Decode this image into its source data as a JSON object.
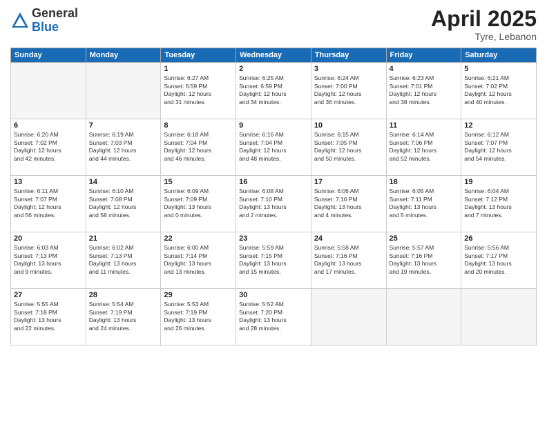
{
  "logo": {
    "general": "General",
    "blue": "Blue"
  },
  "title": {
    "month": "April 2025",
    "location": "Tyre, Lebanon"
  },
  "headers": [
    "Sunday",
    "Monday",
    "Tuesday",
    "Wednesday",
    "Thursday",
    "Friday",
    "Saturday"
  ],
  "weeks": [
    [
      {
        "day": "",
        "info": ""
      },
      {
        "day": "",
        "info": ""
      },
      {
        "day": "1",
        "info": "Sunrise: 6:27 AM\nSunset: 6:59 PM\nDaylight: 12 hours\nand 31 minutes."
      },
      {
        "day": "2",
        "info": "Sunrise: 6:25 AM\nSunset: 6:59 PM\nDaylight: 12 hours\nand 34 minutes."
      },
      {
        "day": "3",
        "info": "Sunrise: 6:24 AM\nSunset: 7:00 PM\nDaylight: 12 hours\nand 36 minutes."
      },
      {
        "day": "4",
        "info": "Sunrise: 6:23 AM\nSunset: 7:01 PM\nDaylight: 12 hours\nand 38 minutes."
      },
      {
        "day": "5",
        "info": "Sunrise: 6:21 AM\nSunset: 7:02 PM\nDaylight: 12 hours\nand 40 minutes."
      }
    ],
    [
      {
        "day": "6",
        "info": "Sunrise: 6:20 AM\nSunset: 7:02 PM\nDaylight: 12 hours\nand 42 minutes."
      },
      {
        "day": "7",
        "info": "Sunrise: 6:19 AM\nSunset: 7:03 PM\nDaylight: 12 hours\nand 44 minutes."
      },
      {
        "day": "8",
        "info": "Sunrise: 6:18 AM\nSunset: 7:04 PM\nDaylight: 12 hours\nand 46 minutes."
      },
      {
        "day": "9",
        "info": "Sunrise: 6:16 AM\nSunset: 7:04 PM\nDaylight: 12 hours\nand 48 minutes."
      },
      {
        "day": "10",
        "info": "Sunrise: 6:15 AM\nSunset: 7:05 PM\nDaylight: 12 hours\nand 50 minutes."
      },
      {
        "day": "11",
        "info": "Sunrise: 6:14 AM\nSunset: 7:06 PM\nDaylight: 12 hours\nand 52 minutes."
      },
      {
        "day": "12",
        "info": "Sunrise: 6:12 AM\nSunset: 7:07 PM\nDaylight: 12 hours\nand 54 minutes."
      }
    ],
    [
      {
        "day": "13",
        "info": "Sunrise: 6:11 AM\nSunset: 7:07 PM\nDaylight: 12 hours\nand 56 minutes."
      },
      {
        "day": "14",
        "info": "Sunrise: 6:10 AM\nSunset: 7:08 PM\nDaylight: 12 hours\nand 58 minutes."
      },
      {
        "day": "15",
        "info": "Sunrise: 6:09 AM\nSunset: 7:09 PM\nDaylight: 13 hours\nand 0 minutes."
      },
      {
        "day": "16",
        "info": "Sunrise: 6:08 AM\nSunset: 7:10 PM\nDaylight: 13 hours\nand 2 minutes."
      },
      {
        "day": "17",
        "info": "Sunrise: 6:06 AM\nSunset: 7:10 PM\nDaylight: 13 hours\nand 4 minutes."
      },
      {
        "day": "18",
        "info": "Sunrise: 6:05 AM\nSunset: 7:11 PM\nDaylight: 13 hours\nand 5 minutes."
      },
      {
        "day": "19",
        "info": "Sunrise: 6:04 AM\nSunset: 7:12 PM\nDaylight: 13 hours\nand 7 minutes."
      }
    ],
    [
      {
        "day": "20",
        "info": "Sunrise: 6:03 AM\nSunset: 7:13 PM\nDaylight: 13 hours\nand 9 minutes."
      },
      {
        "day": "21",
        "info": "Sunrise: 6:02 AM\nSunset: 7:13 PM\nDaylight: 13 hours\nand 11 minutes."
      },
      {
        "day": "22",
        "info": "Sunrise: 6:00 AM\nSunset: 7:14 PM\nDaylight: 13 hours\nand 13 minutes."
      },
      {
        "day": "23",
        "info": "Sunrise: 5:59 AM\nSunset: 7:15 PM\nDaylight: 13 hours\nand 15 minutes."
      },
      {
        "day": "24",
        "info": "Sunrise: 5:58 AM\nSunset: 7:16 PM\nDaylight: 13 hours\nand 17 minutes."
      },
      {
        "day": "25",
        "info": "Sunrise: 5:57 AM\nSunset: 7:16 PM\nDaylight: 13 hours\nand 19 minutes."
      },
      {
        "day": "26",
        "info": "Sunrise: 5:56 AM\nSunset: 7:17 PM\nDaylight: 13 hours\nand 20 minutes."
      }
    ],
    [
      {
        "day": "27",
        "info": "Sunrise: 5:55 AM\nSunset: 7:18 PM\nDaylight: 13 hours\nand 22 minutes."
      },
      {
        "day": "28",
        "info": "Sunrise: 5:54 AM\nSunset: 7:19 PM\nDaylight: 13 hours\nand 24 minutes."
      },
      {
        "day": "29",
        "info": "Sunrise: 5:53 AM\nSunset: 7:19 PM\nDaylight: 13 hours\nand 26 minutes."
      },
      {
        "day": "30",
        "info": "Sunrise: 5:52 AM\nSunset: 7:20 PM\nDaylight: 13 hours\nand 28 minutes."
      },
      {
        "day": "",
        "info": ""
      },
      {
        "day": "",
        "info": ""
      },
      {
        "day": "",
        "info": ""
      }
    ]
  ]
}
